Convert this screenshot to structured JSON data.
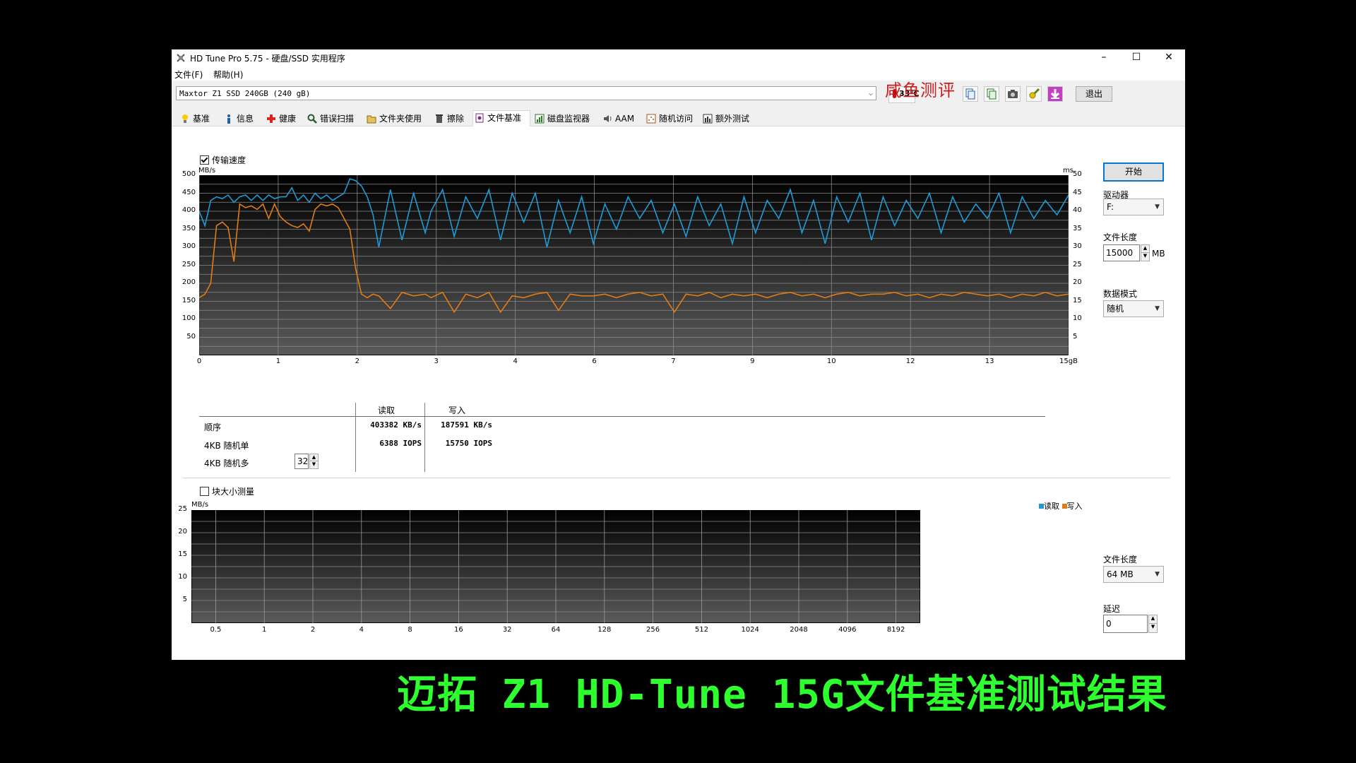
{
  "window": {
    "title": "HD Tune Pro 5.75 - 硬盘/SSD 实用程序",
    "minimize": "–",
    "maximize": "☐",
    "close": "✕"
  },
  "menu": [
    "文件(F)",
    "帮助(H)"
  ],
  "toolbar": {
    "drive": "Maxtor Z1 SSD 240GB (240 gB)",
    "temperature": "33℃",
    "watermark": "咸鱼测评",
    "exit_label": "退出",
    "icons": [
      "copy-text-icon",
      "copy-screen-icon",
      "camera-icon",
      "options-icon",
      "save-icon"
    ]
  },
  "tabs": [
    {
      "label": "基准",
      "icon": "benchmark-icon"
    },
    {
      "label": "信息",
      "icon": "info-icon"
    },
    {
      "label": "健康",
      "icon": "health-icon"
    },
    {
      "label": "错误扫描",
      "icon": "error-scan-icon"
    },
    {
      "label": "文件夹使用",
      "icon": "folder-icon"
    },
    {
      "label": "擦除",
      "icon": "erase-icon"
    },
    {
      "label": "文件基准",
      "icon": "file-benchmark-icon"
    },
    {
      "label": "磁盘监视器",
      "icon": "disk-monitor-icon"
    },
    {
      "label": "AAM",
      "icon": "speaker-icon"
    },
    {
      "label": "随机访问",
      "icon": "random-access-icon"
    },
    {
      "label": "额外测试",
      "icon": "extra-tests-icon"
    }
  ],
  "transfer": {
    "checkbox_label": "传输速度",
    "checked": true
  },
  "results": {
    "col_read": "读取",
    "col_write": "写入",
    "rows": [
      {
        "label": "顺序",
        "read": "403382 KB/s",
        "write": "187591 KB/s"
      },
      {
        "label": "4KB 随机单",
        "read": "6388 IOPS",
        "write": "15750 IOPS"
      },
      {
        "label": "4KB 随机多",
        "read": "",
        "write": ""
      }
    ],
    "queue_depth": "32"
  },
  "block": {
    "checkbox_label": "块大小测量",
    "checked": false,
    "legend_read": "读取",
    "legend_write": "写入"
  },
  "sidebar": {
    "start_label": "开始",
    "drive_label": "驱动器",
    "drive_value": "F:",
    "file_length_label": "文件长度",
    "file_length_value": "15000",
    "file_length_unit": "MB",
    "data_mode_label": "数据模式",
    "data_mode_value": "随机",
    "file_length2_label": "文件长度",
    "file_length2_value": "64 MB",
    "delay_label": "延迟",
    "delay_value": "0"
  },
  "caption": "迈拓 Z1 HD-Tune 15G文件基准测试结果",
  "chart_data": [
    {
      "type": "line",
      "ylabel": "MB/s",
      "y2label": "ms",
      "ylim": [
        0,
        500
      ],
      "y2lim": [
        0,
        50
      ],
      "yticks": [
        50,
        100,
        150,
        200,
        250,
        300,
        350,
        400,
        450,
        500
      ],
      "y2ticks": [
        5,
        10,
        15,
        20,
        25,
        30,
        35,
        40,
        45,
        50
      ],
      "xticks": [
        "0",
        "1",
        "2",
        "3",
        "4",
        "6",
        "7",
        "9",
        "10",
        "12",
        "13",
        "15gB"
      ],
      "xlim": [
        0,
        15
      ],
      "colors": {
        "read": "#1e9ad6",
        "write": "#e07b16"
      },
      "series": [
        {
          "id": "read",
          "x": [
            0,
            0.1,
            0.2,
            0.3,
            0.4,
            0.5,
            0.6,
            0.7,
            0.8,
            0.9,
            1.0,
            1.1,
            1.2,
            1.3,
            1.4,
            1.5,
            1.6,
            1.7,
            1.8,
            1.9,
            2.0,
            2.1,
            2.2,
            2.3,
            2.4,
            2.5,
            2.6,
            2.7,
            2.8,
            2.9,
            3.0,
            3.1,
            3.3,
            3.5,
            3.7,
            3.9,
            4.0,
            4.2,
            4.4,
            4.6,
            4.8,
            5.0,
            5.2,
            5.4,
            5.6,
            5.8,
            6.0,
            6.2,
            6.4,
            6.6,
            6.8,
            7.0,
            7.2,
            7.4,
            7.6,
            7.8,
            8.0,
            8.2,
            8.4,
            8.6,
            8.8,
            9.0,
            9.2,
            9.4,
            9.6,
            9.8,
            10.0,
            10.2,
            10.4,
            10.6,
            10.8,
            11.0,
            11.2,
            11.4,
            11.6,
            11.8,
            12.0,
            12.2,
            12.4,
            12.6,
            12.8,
            13.0,
            13.2,
            13.4,
            13.6,
            13.8,
            14.0,
            14.2,
            14.4,
            14.6,
            14.8,
            15.0
          ],
          "y": [
            400,
            360,
            430,
            440,
            435,
            445,
            425,
            440,
            445,
            430,
            445,
            430,
            445,
            435,
            440,
            440,
            465,
            430,
            445,
            425,
            450,
            435,
            445,
            430,
            440,
            450,
            490,
            485,
            470,
            440,
            390,
            300,
            460,
            320,
            450,
            340,
            400,
            460,
            330,
            440,
            380,
            460,
            320,
            450,
            370,
            450,
            300,
            430,
            340,
            440,
            310,
            420,
            350,
            440,
            380,
            430,
            340,
            420,
            330,
            440,
            360,
            420,
            310,
            440,
            340,
            430,
            380,
            460,
            340,
            430,
            310,
            440,
            370,
            450,
            320,
            440,
            360,
            430,
            380,
            450,
            340,
            440,
            370,
            420,
            380,
            450,
            340,
            440,
            380,
            430,
            390,
            445
          ]
        },
        {
          "id": "write",
          "x": [
            0,
            0.1,
            0.2,
            0.3,
            0.4,
            0.5,
            0.6,
            0.7,
            0.8,
            0.9,
            1.0,
            1.1,
            1.2,
            1.3,
            1.4,
            1.5,
            1.6,
            1.7,
            1.8,
            1.9,
            2.0,
            2.1,
            2.2,
            2.3,
            2.4,
            2.5,
            2.6,
            2.7,
            2.8,
            2.9,
            3.0,
            3.1,
            3.3,
            3.5,
            3.7,
            3.9,
            4.0,
            4.2,
            4.4,
            4.6,
            4.8,
            5.0,
            5.2,
            5.4,
            5.6,
            5.8,
            6.0,
            6.2,
            6.4,
            6.6,
            6.8,
            7.0,
            7.2,
            7.4,
            7.6,
            7.8,
            8.0,
            8.2,
            8.4,
            8.6,
            8.8,
            9.0,
            9.2,
            9.4,
            9.6,
            9.8,
            10.0,
            10.2,
            10.4,
            10.6,
            10.8,
            11.0,
            11.2,
            11.4,
            11.6,
            11.8,
            12.0,
            12.2,
            12.4,
            12.6,
            12.8,
            13.0,
            13.2,
            13.4,
            13.6,
            13.8,
            14.0,
            14.2,
            14.4,
            14.6,
            14.8,
            15.0
          ],
          "y": [
            160,
            170,
            200,
            360,
            370,
            355,
            260,
            420,
            410,
            415,
            405,
            420,
            380,
            420,
            385,
            370,
            360,
            355,
            365,
            345,
            405,
            420,
            415,
            420,
            410,
            380,
            350,
            240,
            170,
            160,
            170,
            165,
            130,
            175,
            165,
            170,
            160,
            175,
            120,
            170,
            160,
            175,
            120,
            165,
            160,
            170,
            175,
            125,
            170,
            165,
            165,
            170,
            160,
            170,
            175,
            165,
            170,
            120,
            170,
            165,
            175,
            160,
            170,
            165,
            170,
            160,
            170,
            175,
            165,
            170,
            160,
            170,
            175,
            165,
            170,
            170,
            175,
            165,
            170,
            160,
            170,
            165,
            175,
            170,
            165,
            170,
            160,
            170,
            165,
            175,
            165,
            170
          ]
        }
      ]
    },
    {
      "type": "bar",
      "ylabel": "MB/s",
      "ylim": [
        0,
        25
      ],
      "yticks": [
        5,
        10,
        15,
        20,
        25
      ],
      "categories": [
        "0.5",
        "1",
        "2",
        "4",
        "8",
        "16",
        "32",
        "64",
        "128",
        "256",
        "512",
        "1024",
        "2048",
        "4096",
        "8192"
      ],
      "series": [
        {
          "name": "读取",
          "values": []
        },
        {
          "name": "写入",
          "values": []
        }
      ]
    }
  ]
}
